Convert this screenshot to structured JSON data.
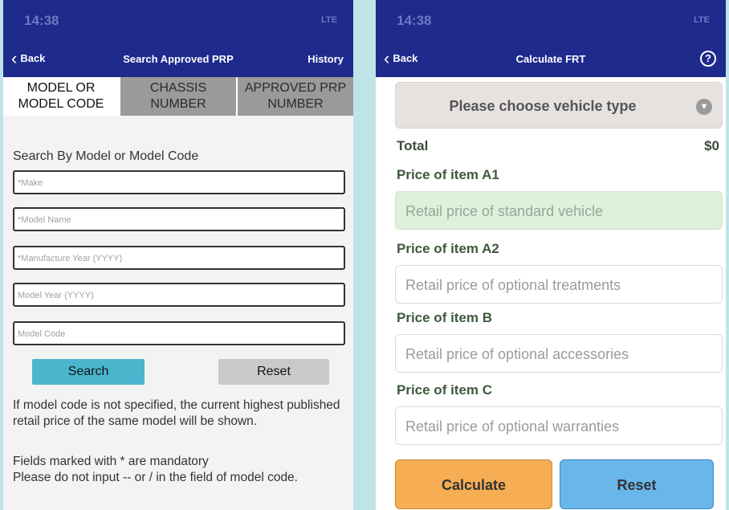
{
  "left": {
    "status_time": "14:38",
    "status_signal": "LTE",
    "nav": {
      "back": "Back",
      "title": "Search Approved PRP",
      "right": "History"
    },
    "tabs": [
      {
        "label": "MODEL OR MODEL CODE"
      },
      {
        "label": "CHASSIS NUMBER"
      },
      {
        "label": "APPROVED PRP NUMBER"
      }
    ],
    "section_label": "Search By Model or Model Code",
    "fields": {
      "make": "*Make",
      "model_name": "*Model Name",
      "manufacture_year": "*Manufacture Year (YYYY)",
      "model_year": "Model Year (YYYY)",
      "model_code": "Model Code"
    },
    "search_label": "Search",
    "reset_label": "Reset",
    "note1": "If model code is not specified, the current highest published retail price of the same model will be shown.",
    "note2": "Fields marked with * are mandatory",
    "note3": "Please do not input -- or / in the field of model code."
  },
  "right": {
    "status_time": "14:38",
    "status_signal": "LTE",
    "nav": {
      "back": "Back",
      "title": "Calculate FRT",
      "help": "?"
    },
    "vehicle_type": "Please choose vehicle type",
    "total_label": "Total",
    "total_value": "$0",
    "items": [
      {
        "label": "Price of item A1",
        "placeholder": "Retail price of standard vehicle"
      },
      {
        "label": "Price of item A2",
        "placeholder": "Retail price of optional treatments"
      },
      {
        "label": "Price of item B",
        "placeholder": "Retail price of optional accessories"
      },
      {
        "label": "Price of item C",
        "placeholder": "Retail price of optional warranties"
      }
    ],
    "calculate_label": "Calculate",
    "reset_label": "Reset"
  },
  "colors": {
    "navbar": "#1e2a8c",
    "search_button": "#4ab6cd",
    "calculate_button": "#f6ad53",
    "reset_button": "#69b6ea"
  }
}
